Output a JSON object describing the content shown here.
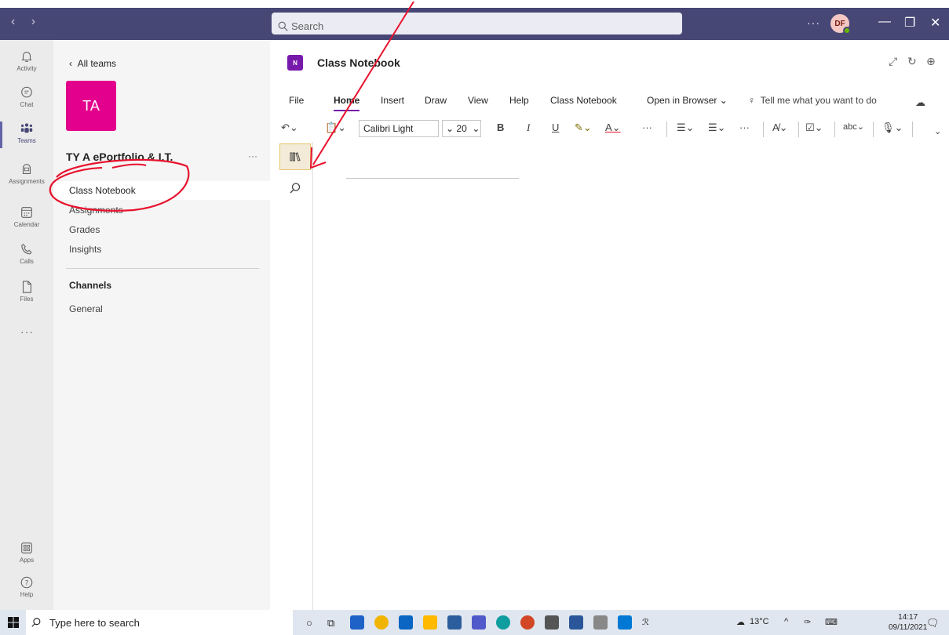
{
  "titlebar": {
    "nav": "‹ ›",
    "search_placeholder": "Search",
    "more": "···",
    "avatar_initials": "DF",
    "minimize": "—",
    "restore": "❐",
    "close": "✕"
  },
  "rail": {
    "items": [
      {
        "label": "Activity",
        "icon": "bell-icon"
      },
      {
        "label": "Chat",
        "icon": "chat-icon"
      },
      {
        "label": "Teams",
        "icon": "teams-icon"
      },
      {
        "label": "Assignments",
        "icon": "assignments-icon"
      },
      {
        "label": "Calendar",
        "icon": "calendar-icon"
      },
      {
        "label": "Calls",
        "icon": "phone-icon"
      },
      {
        "label": "Files",
        "icon": "file-icon"
      }
    ],
    "more": "···",
    "apps_label": "Apps",
    "help_label": "Help"
  },
  "team": {
    "back_label": "All teams",
    "tile_initials": "TA",
    "tile_color": "#e3008c",
    "name": "TY A ePortfolio & I.T.",
    "more": "···",
    "nav": [
      "Class Notebook",
      "Assignments",
      "Grades",
      "Insights"
    ],
    "channels_header": "Channels",
    "channels": [
      "General"
    ]
  },
  "app": {
    "logo_text": "N",
    "title": "Class Notebook",
    "header_icons": [
      "expand-icon",
      "refresh-icon",
      "globe-icon"
    ]
  },
  "ribbon": {
    "tabs": [
      "File",
      "Home",
      "Insert",
      "Draw",
      "View",
      "Help",
      "Class Notebook",
      "Open in Browser ⌄"
    ],
    "active_tab": "Home",
    "tell_me": "Tell me what you want to do",
    "font_name": "Calibri Light",
    "font_size": "20",
    "bold": "B",
    "italic": "I",
    "underline": "U",
    "more": "···"
  },
  "taskbar": {
    "search_placeholder": "Type here to search",
    "temperature": "13°C",
    "time": "14:17",
    "date": "09/11/2021"
  },
  "colors": {
    "titlebar": "#464775",
    "accent": "#6264a7",
    "onenote": "#7719aa",
    "annotation": "#e8112d"
  }
}
